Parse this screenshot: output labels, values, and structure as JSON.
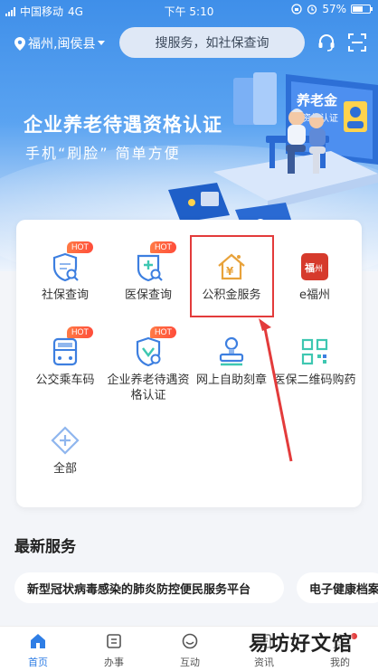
{
  "status_bar": {
    "carrier": "中国移动",
    "network": "4G",
    "time": "下午 5:10",
    "battery": "57%"
  },
  "header": {
    "location": "福州,闽侯县",
    "search_placeholder": "搜服务，如社保查询",
    "icons": [
      "location-pin-icon",
      "chevron-down-icon",
      "headset-icon",
      "scan-icon"
    ]
  },
  "banner": {
    "title": "企业养老待遇资格认证",
    "subtitle": "手机“刷脸”  简单方便",
    "sign_text_1": "养老金",
    "sign_text_2": "资格认证"
  },
  "services": {
    "items": [
      {
        "label": "社保查询",
        "hot": "HOT",
        "icon": "social-security-shield-icon"
      },
      {
        "label": "医保查询",
        "hot": "HOT",
        "icon": "medical-insurance-icon"
      },
      {
        "label": "公积金服务",
        "hot": "",
        "icon": "housing-fund-house-icon"
      },
      {
        "label": "e福州",
        "hot": "",
        "icon": "efuzhou-logo-icon",
        "logo_text": "福州"
      },
      {
        "label": "公交乘车码",
        "hot": "HOT",
        "icon": "bus-code-icon"
      },
      {
        "label": "企业养老待遇资格认证",
        "hot": "HOT",
        "icon": "pension-verify-icon"
      },
      {
        "label": "网上自助刻章",
        "hot": "",
        "icon": "stamp-icon"
      },
      {
        "label": "医保二维码购药",
        "hot": "",
        "icon": "qr-medicine-icon"
      },
      {
        "label": "全部",
        "hot": "",
        "icon": "all-services-icon"
      }
    ]
  },
  "latest": {
    "title": "最新服务",
    "chips": [
      "新型冠状病毒感染的肺炎防控便民服务平台",
      "电子健康档案"
    ]
  },
  "tabbar": {
    "tabs": [
      {
        "label": "首页",
        "active": true,
        "icon": "home-icon"
      },
      {
        "label": "办事",
        "active": false,
        "icon": "affairs-icon"
      },
      {
        "label": "互动",
        "active": false,
        "icon": "interact-icon"
      },
      {
        "label": "资讯",
        "active": false,
        "icon": "news-icon"
      },
      {
        "label": "我的",
        "active": false,
        "icon": "profile-icon"
      }
    ]
  },
  "watermark": "易坊好文馆",
  "colors": {
    "accent": "#2f7ee5",
    "hot": "#ff5a3c",
    "highlight": "#e33b3b"
  }
}
